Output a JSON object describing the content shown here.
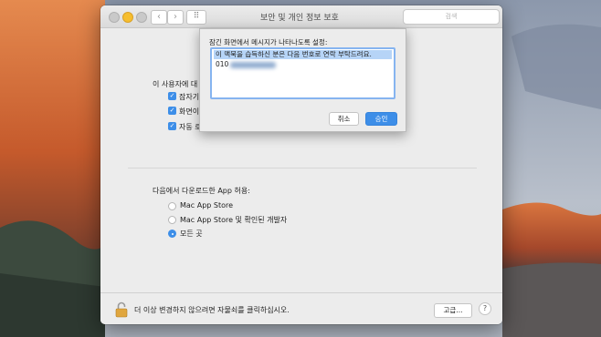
{
  "window": {
    "title": "보안 및 개인 정보 보호",
    "search_placeholder": "검색",
    "nav_back_glyph": "‹",
    "nav_forward_glyph": "›",
    "grid_glyph": "⠿",
    "icons": [
      "close-light",
      "minimize-light",
      "zoom-light",
      "back-icon",
      "forward-icon",
      "grid-icon",
      "lock-icon",
      "help-icon"
    ]
  },
  "user_section": {
    "heading": "이 사용자에 대",
    "checkboxes": [
      {
        "label": "잠자기",
        "checked": true
      },
      {
        "label": "화면이",
        "checked": true
      },
      {
        "label": "자동 로",
        "checked": true
      }
    ],
    "check_glyph": "✓"
  },
  "downloads": {
    "heading": "다음에서 다운로드한 App 허용:",
    "options": [
      {
        "label": "Mac App Store",
        "selected": false
      },
      {
        "label": "Mac App Store 및 확인된 개발자",
        "selected": false
      },
      {
        "label": "모든 곳",
        "selected": true
      }
    ]
  },
  "footer": {
    "lock_message": "더 이상 변경하지 않으려면 자물쇠를 클릭하십시오.",
    "advanced_button": "고급...",
    "help_glyph": "?"
  },
  "sheet": {
    "title": "잠긴 화면에서 메시지가 나타나도록 설정:",
    "message_line1": "이 맥북을 습득하신 분은 다음 번호로 연락 부탁드려요.",
    "message_line2": "010",
    "cancel_button": "취소",
    "ok_button": "승인"
  },
  "colors": {
    "accent": "#3d8ee8",
    "selection": "#b6d4f7",
    "window_bg": "#ececec",
    "minimize": "#f6be2f"
  }
}
